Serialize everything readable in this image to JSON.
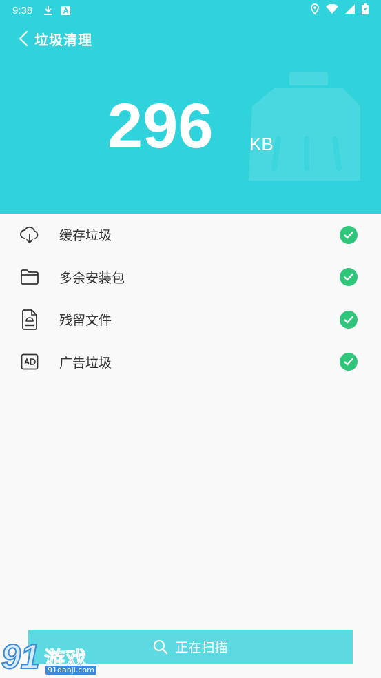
{
  "status_bar": {
    "time": "9:38"
  },
  "header": {
    "title": "垃圾清理",
    "size_value": "296",
    "size_unit": "KB"
  },
  "items": [
    {
      "label": "缓存垃圾",
      "icon": "cloud-download-icon",
      "checked": true
    },
    {
      "label": "多余安装包",
      "icon": "folder-icon",
      "checked": true
    },
    {
      "label": "残留文件",
      "icon": "apk-file-icon",
      "checked": true
    },
    {
      "label": "广告垃圾",
      "icon": "ad-icon",
      "checked": true
    }
  ],
  "scan_button": {
    "label": "正在扫描"
  },
  "watermark": {
    "nine": "91",
    "text": "游戏",
    "site": "91danji.com"
  },
  "colors": {
    "header_bg": "#30d3db",
    "check_green": "#2fc57b",
    "button_bg": "#5cd9e1"
  }
}
